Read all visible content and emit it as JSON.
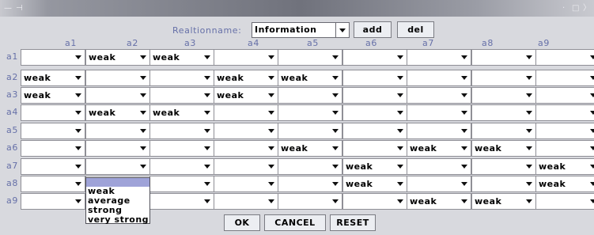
{
  "titlebar": {
    "menu_icon": "window-menu-icon",
    "pin_icon": "pin-icon",
    "min_glyph": "·",
    "max_glyph": "□",
    "close_glyph": "〉"
  },
  "relation": {
    "label": "Realtionname:",
    "value": "Information",
    "add_label": "add",
    "del_label": "del"
  },
  "columns": [
    "a1",
    "a2",
    "a3",
    "a4",
    "a5",
    "a6",
    "a7",
    "a8",
    "a9"
  ],
  "rows": [
    {
      "label": "a1",
      "cells": [
        "",
        "weak",
        "weak",
        "",
        "",
        "",
        "",
        "",
        ""
      ]
    },
    {
      "label": "a2",
      "cells": [
        "weak",
        "",
        "",
        "weak",
        "weak",
        "",
        "",
        "",
        ""
      ]
    },
    {
      "label": "a3",
      "cells": [
        "weak",
        "",
        "",
        "weak",
        "",
        "",
        "",
        "",
        ""
      ]
    },
    {
      "label": "a4",
      "cells": [
        "",
        "weak",
        "weak",
        "",
        "",
        "",
        "",
        "",
        ""
      ]
    },
    {
      "label": "a5",
      "cells": [
        "",
        "",
        "",
        "",
        "",
        "",
        "",
        "",
        ""
      ]
    },
    {
      "label": "a6",
      "cells": [
        "",
        "",
        "",
        "",
        "weak",
        "",
        "weak",
        "weak",
        ""
      ]
    },
    {
      "label": "a7",
      "cells": [
        "",
        "",
        "",
        "",
        "",
        "weak",
        "",
        "",
        "weak"
      ]
    },
    {
      "label": "a8",
      "cells": [
        "",
        "",
        "",
        "",
        "",
        "weak",
        "",
        "",
        "weak"
      ]
    },
    {
      "label": "a9",
      "cells": [
        "",
        "",
        "",
        "",
        "",
        "",
        "weak",
        "weak",
        ""
      ]
    }
  ],
  "dropdown_options": [
    "weak",
    "average",
    "strong",
    "very strong"
  ],
  "footer": {
    "ok_label": "OK",
    "cancel_label": "CANCEL",
    "reset_label": "RESET"
  }
}
